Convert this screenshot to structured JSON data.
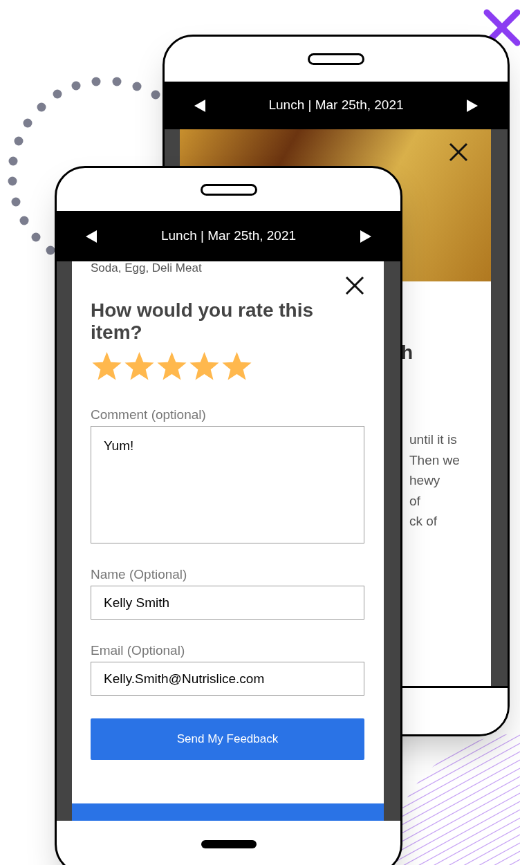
{
  "back_screen": {
    "header": {
      "title": "Lunch | Mar 25th, 2021"
    },
    "heading_fragment": "h",
    "description_fragments": [
      "until it is",
      "Then we",
      "hewy",
      "of",
      "ck of"
    ]
  },
  "front_screen": {
    "header": {
      "title": "Lunch | Mar 25th, 2021"
    },
    "modal": {
      "ingredients": "Soda, Egg, Deli Meat",
      "question": "How would you rate this item?",
      "stars": 5,
      "fields": [
        {
          "kind": "textarea",
          "label": "Comment (optional)",
          "value": "Yum!"
        },
        {
          "kind": "input",
          "label": "Name (Optional)",
          "value": "Kelly Smith"
        },
        {
          "kind": "input",
          "label": "Email (Optional)",
          "value": "Kelly.Smith@Nutrislice.com"
        }
      ],
      "submit": "Send My Feedback"
    }
  }
}
